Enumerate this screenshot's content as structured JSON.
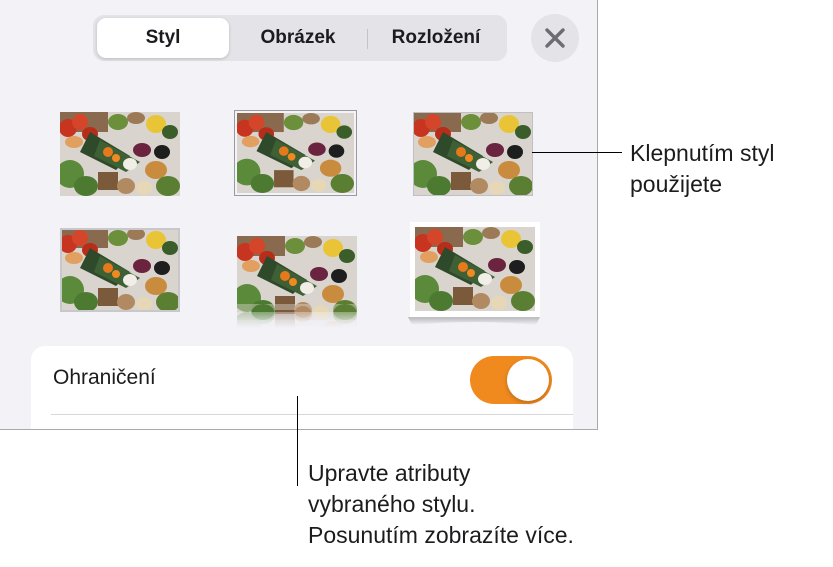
{
  "tabs": [
    {
      "label": "Styl",
      "active": true
    },
    {
      "label": "Obrázek",
      "active": false
    },
    {
      "label": "Rozložení",
      "active": false
    }
  ],
  "close_icon": "close-icon",
  "style_presets": {
    "count": 6,
    "selected_index": 1,
    "image": "food-ingredients-photo"
  },
  "border_row": {
    "label": "Ohraničení",
    "toggle_on": true
  },
  "colors": {
    "accent_toggle": "#f0891e",
    "panel_background": "#f2f2f7",
    "card_background": "#ffffff"
  },
  "callouts": {
    "style_tap": {
      "line1": "Klepnutím styl",
      "line2": "použijete"
    },
    "attributes": {
      "line1": "Upravte atributy",
      "line2": "vybraného stylu.",
      "line3": "Posunutím zobrazíte více."
    }
  }
}
